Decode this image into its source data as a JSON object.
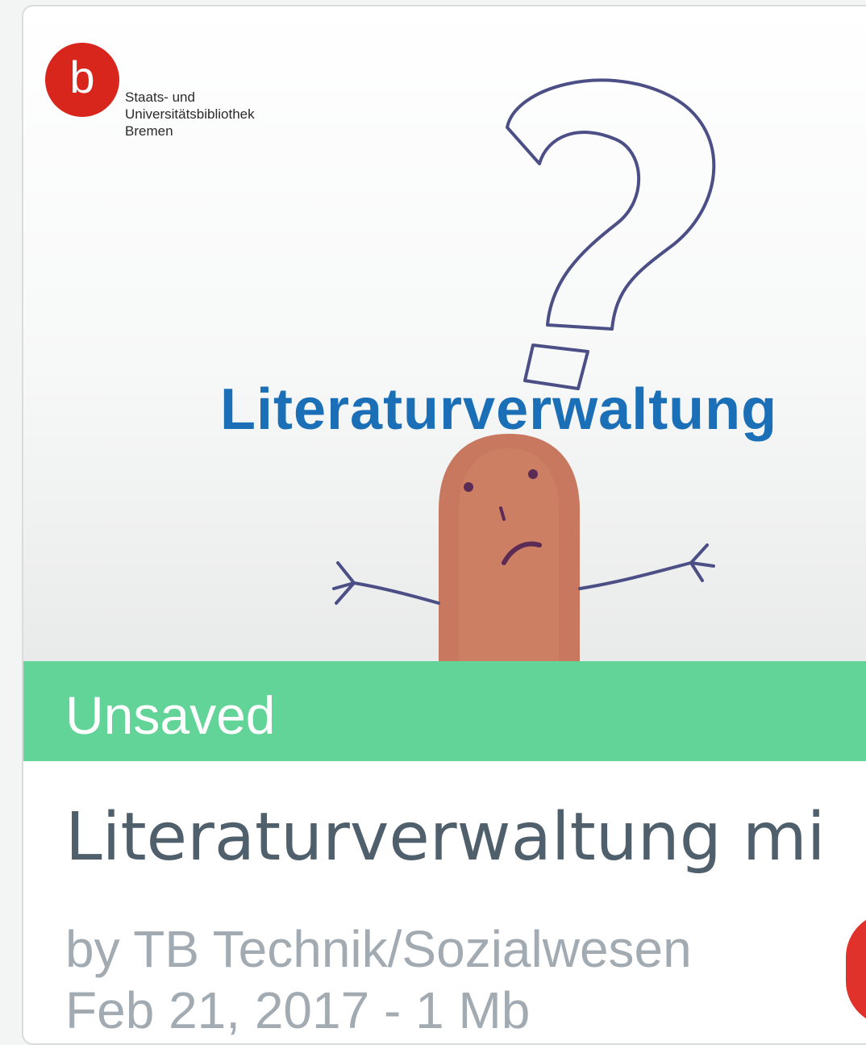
{
  "card": {
    "thumbnail": {
      "logo": {
        "letter": "b",
        "line1": "Staats- und",
        "line2": "Universitätsbibliothek",
        "line3": "Bremen"
      },
      "overlay_title": "Literaturverwaltung"
    },
    "status": "Unsaved",
    "title": "Literaturverwaltung mi",
    "author": "by TB Technik/Sozialwesen",
    "meta": "Feb 21, 2017 - 1 Mb"
  },
  "colors": {
    "status_green": "#63d498",
    "title_gray": "#4f5f6b",
    "meta_gray": "#a3abb2",
    "brand_red": "#d9261c",
    "overlay_blue": "#1a6fb7"
  }
}
